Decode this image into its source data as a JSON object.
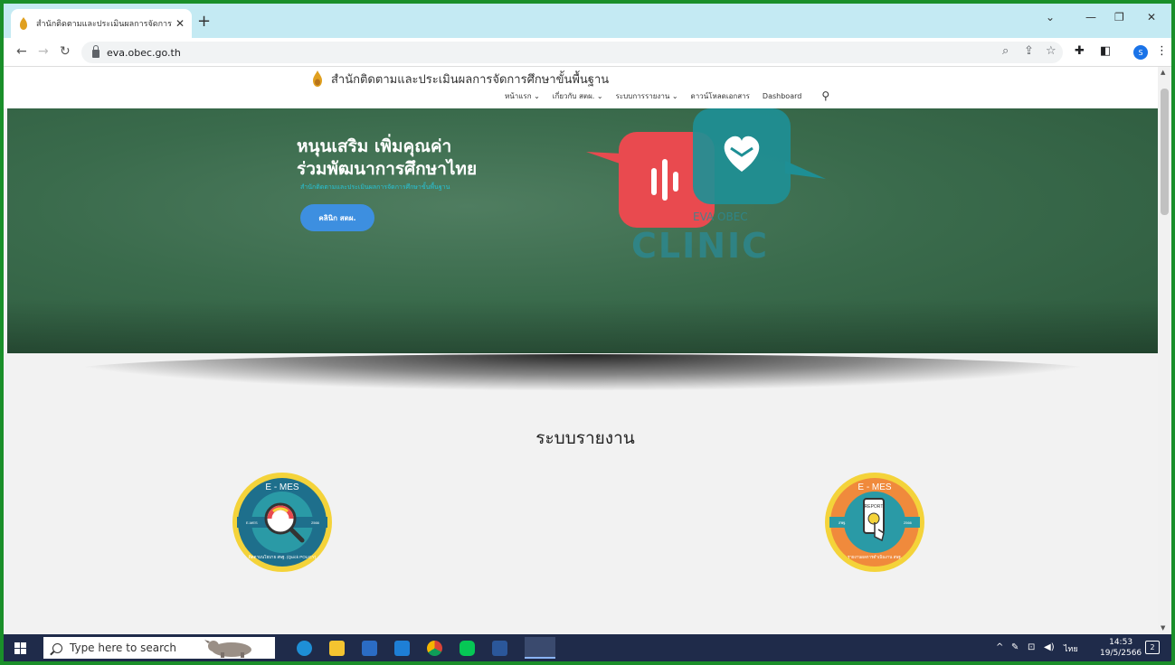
{
  "browser": {
    "tab_title": "สำนักติดตามและประเมินผลการจัดการศึ",
    "tab_close": "✕",
    "new_tab": "+",
    "url": "eva.obec.go.th",
    "profile_initial": "S"
  },
  "site": {
    "title": "สำนักติดตามและประเมินผลการจัดการศึกษาขั้นพื้นฐาน",
    "nav": [
      "หน้าแรก ⌄",
      "เกี่ยวกับ สตผ. ⌄",
      "ระบบการรายงาน ⌄",
      "ดาวน์โหลดเอกสาร",
      "Dashboard"
    ]
  },
  "hero": {
    "headline_1": "หนุนเสริม เพิ่มคุณค่า",
    "headline_2": "ร่วมพัฒนาการศึกษาไทย",
    "subtitle": "สำนักติดตามและประเมินผลการจัดการศึกษาขั้นพื้นฐาน",
    "button": "คลินิก สตผ.",
    "logo_text": "CLINIC",
    "logo_caption": "EVA OBEC"
  },
  "section": {
    "title": "ระบบรายงาน",
    "badges": [
      {
        "top": "E - MES",
        "side_left": "E-MES",
        "side_right": "2566",
        "ring_text": "ติดตามนโยบาย สพฐ. (Quick POLICY)"
      },
      {
        "top": "E - MES",
        "side_left": "สพฐ.",
        "side_right": "2566",
        "ring_text": "รายงานผลการดำเนินงาน สพฐ.",
        "screen": "REPORT"
      }
    ]
  },
  "taskbar": {
    "search_placeholder": "Type here to search",
    "lang": "ไทย",
    "time": "14:53",
    "date": "19/5/2566",
    "notif_count": "2"
  },
  "colors": {
    "accent_blue": "#3d8fe0",
    "hero_green": "#3a6b4c",
    "tabstrip": "#c4eaf3",
    "taskbar": "#1f2b4a",
    "outer_border": "#1a8f2a"
  }
}
